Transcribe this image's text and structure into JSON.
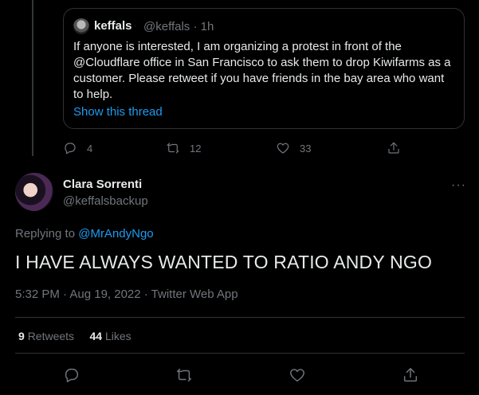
{
  "quoted": {
    "name": "keffals",
    "handle": "@keffals · 1h",
    "text": "If anyone is interested, I am organizing a protest in front of the @Cloudflare office in San Francisco to ask them to drop Kiwifarms as a customer. Please retweet if you have friends in the bay area who want to help.",
    "show_thread": "Show this thread"
  },
  "quoted_actions": {
    "replies": "4",
    "retweets": "12",
    "likes": "33"
  },
  "tweet": {
    "display_name": "Clara Sorrenti",
    "handle": "@keffalsbackup",
    "more": "···",
    "replying_prefix": "Replying to",
    "replying_to": "@MrAndyNgo",
    "text": "I HAVE ALWAYS WANTED TO RATIO ANDY NGO",
    "timestamp": "5:32 PM · Aug 19, 2022 · Twitter Web App"
  },
  "stats": {
    "retweets_count": "9",
    "retweets_label": "Retweets",
    "likes_count": "44",
    "likes_label": "Likes"
  },
  "icons": [
    "reply-icon",
    "retweet-icon",
    "like-icon",
    "share-icon",
    "more-icon"
  ],
  "colors": {
    "link": "#1d9bf0",
    "muted": "#71767b",
    "text": "#e7e9ea",
    "border": "#2f3336",
    "background": "#000000"
  }
}
